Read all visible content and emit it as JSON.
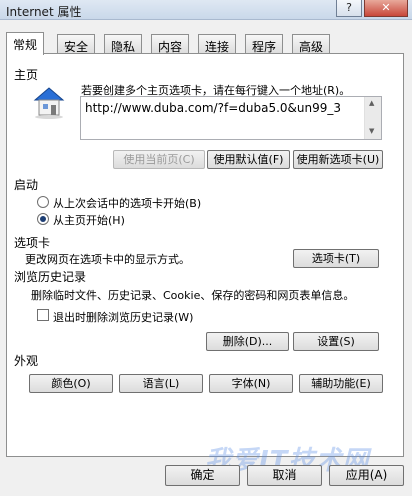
{
  "window": {
    "title": "Internet 属性",
    "help_glyph": "?",
    "close_glyph": "✕"
  },
  "tabs": [
    {
      "label": "常规"
    },
    {
      "label": "安全"
    },
    {
      "label": "隐私"
    },
    {
      "label": "内容"
    },
    {
      "label": "连接"
    },
    {
      "label": "程序"
    },
    {
      "label": "高级"
    }
  ],
  "home": {
    "section": "主页",
    "hint": "若要创建多个主页选项卡，请在每行键入一个地址(R)。",
    "url": "http://www.duba.com/?f=duba5.0&un99_3",
    "btn_current": "使用当前页(C)",
    "btn_default": "使用默认值(F)",
    "btn_newtab": "使用新选项卡(U)"
  },
  "startup": {
    "section": "启动",
    "option_last": "从上次会话中的选项卡开始(B)",
    "option_home": "从主页开始(H)"
  },
  "tabs_section": {
    "section": "选项卡",
    "desc": "更改网页在选项卡中的显示方式。",
    "btn": "选项卡(T)"
  },
  "history": {
    "section": "浏览历史记录",
    "desc": "删除临时文件、历史记录、Cookie、保存的密码和网页表单信息。",
    "checkbox": "退出时删除浏览历史记录(W)",
    "btn_delete": "删除(D)...",
    "btn_settings": "设置(S)"
  },
  "appearance": {
    "section": "外观",
    "btn_colors": "颜色(O)",
    "btn_languages": "语言(L)",
    "btn_fonts": "字体(N)",
    "btn_access": "辅助功能(E)"
  },
  "footer": {
    "ok": "确定",
    "cancel": "取消",
    "apply": "应用(A)"
  },
  "watermark": "我爱IT技术网",
  "colors": {
    "radio_dot": "#1d3e74"
  }
}
